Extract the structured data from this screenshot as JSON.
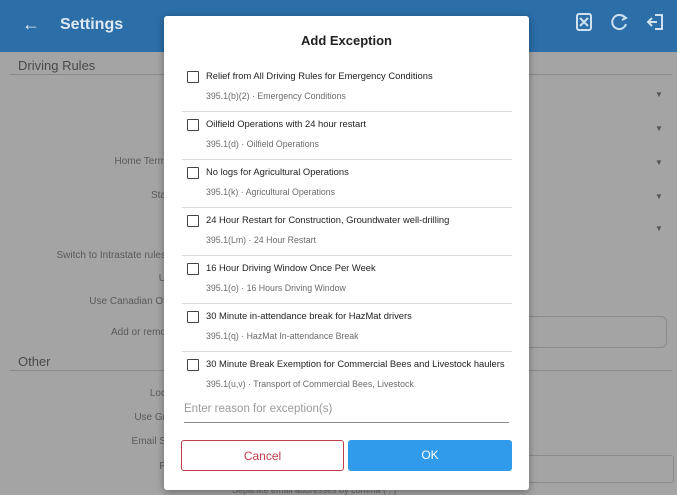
{
  "appbar": {
    "title": "Settings",
    "back_icon": "←",
    "icons": [
      "sync-disabled-icon",
      "refresh-icon",
      "logout-icon"
    ]
  },
  "background": {
    "section_driving_rules": "Driving Rules",
    "section_other": "Other",
    "labels": [
      "Home Term",
      "Sta",
      "Switch to Intrastate rules",
      "U",
      "Use Canadian Of",
      "Add or remo",
      "Loc",
      "Use Gr",
      "Email S",
      "P"
    ],
    "email_hint": "Separate email addresses by comma ( , )"
  },
  "dialog": {
    "title": "Add Exception",
    "items": [
      {
        "name": "Relief from All Driving Rules for Emergency Conditions",
        "code": "395.1(b)(2)  ·  Emergency Conditions"
      },
      {
        "name": "Oilfield Operations with 24 hour restart",
        "code": "395.1(d)  ·  Oilfield Operations"
      },
      {
        "name": "No logs for Agricultural Operations",
        "code": "395.1(k)  ·  Agricultural Operations"
      },
      {
        "name": "24 Hour Restart for Construction, Groundwater well-drilling",
        "code": "395.1(Lm)  ·  24 Hour Restart"
      },
      {
        "name": "16 Hour Driving Window Once Per Week",
        "code": "395.1(o)  ·  16 Hours Driving Window"
      },
      {
        "name": "30 Minute in-attendance break for HazMat drivers",
        "code": "395.1(q)  ·  HazMat In-attendance Break"
      },
      {
        "name": "30 Minute Break Exemption for Commercial Bees and Livestock haulers",
        "code": "395.1(u,v)  ·  Transport of Commercial Bees, Livestock"
      }
    ],
    "reason_placeholder": "Enter reason for exception(s)",
    "reason_value": "",
    "cancel_label": "Cancel",
    "ok_label": "OK"
  },
  "colors": {
    "appbar": "#2b6ea8",
    "ok_button": "#2f9bea",
    "cancel_accent": "#c4394c"
  }
}
